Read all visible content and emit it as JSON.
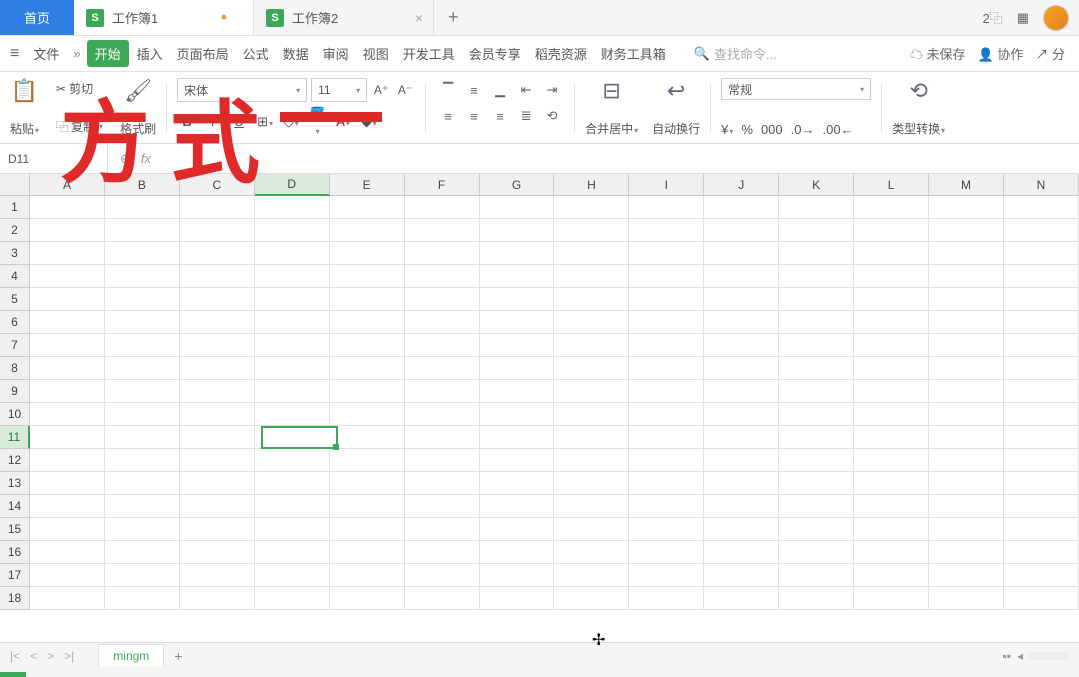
{
  "titlebar": {
    "home": "首页",
    "tabs": [
      {
        "label": "工作簿1",
        "dirty": "•",
        "close": "×"
      },
      {
        "label": "工作簿2",
        "dirty": "",
        "close": "×"
      }
    ],
    "new": "+",
    "winNum": "2"
  },
  "menu": {
    "file": "文件",
    "more": "»",
    "items": [
      "开始",
      "插入",
      "页面布局",
      "公式",
      "数据",
      "审阅",
      "视图",
      "开发工具",
      "会员专享",
      "稻壳资源",
      "财务工具箱"
    ],
    "searchPlaceholder": "查找命令...",
    "unsaved": "未保存",
    "collab": "协作",
    "share": "分"
  },
  "ribbon": {
    "paste": "粘贴",
    "cut": "剪切",
    "copy": "复制",
    "format_painter": "格式刷",
    "font": "宋体",
    "fontSize": "11",
    "mergeCenter": "合并居中",
    "autoWrap": "自动换行",
    "numberFormat": "常规",
    "typeConvert": "类型转换"
  },
  "formula": {
    "nameBox": "D11",
    "fx": "fx"
  },
  "grid": {
    "cols": [
      "A",
      "B",
      "C",
      "D",
      "E",
      "F",
      "G",
      "H",
      "I",
      "J",
      "K",
      "L",
      "M",
      "N"
    ],
    "rows": [
      "1",
      "2",
      "3",
      "4",
      "5",
      "6",
      "7",
      "8",
      "9",
      "10",
      "11",
      "12",
      "13",
      "14",
      "15",
      "16",
      "17",
      "18"
    ],
    "selectedCol": 3,
    "selectedRow": 10
  },
  "sheets": {
    "active": "mingm",
    "add": "+"
  },
  "annotation": "方式"
}
